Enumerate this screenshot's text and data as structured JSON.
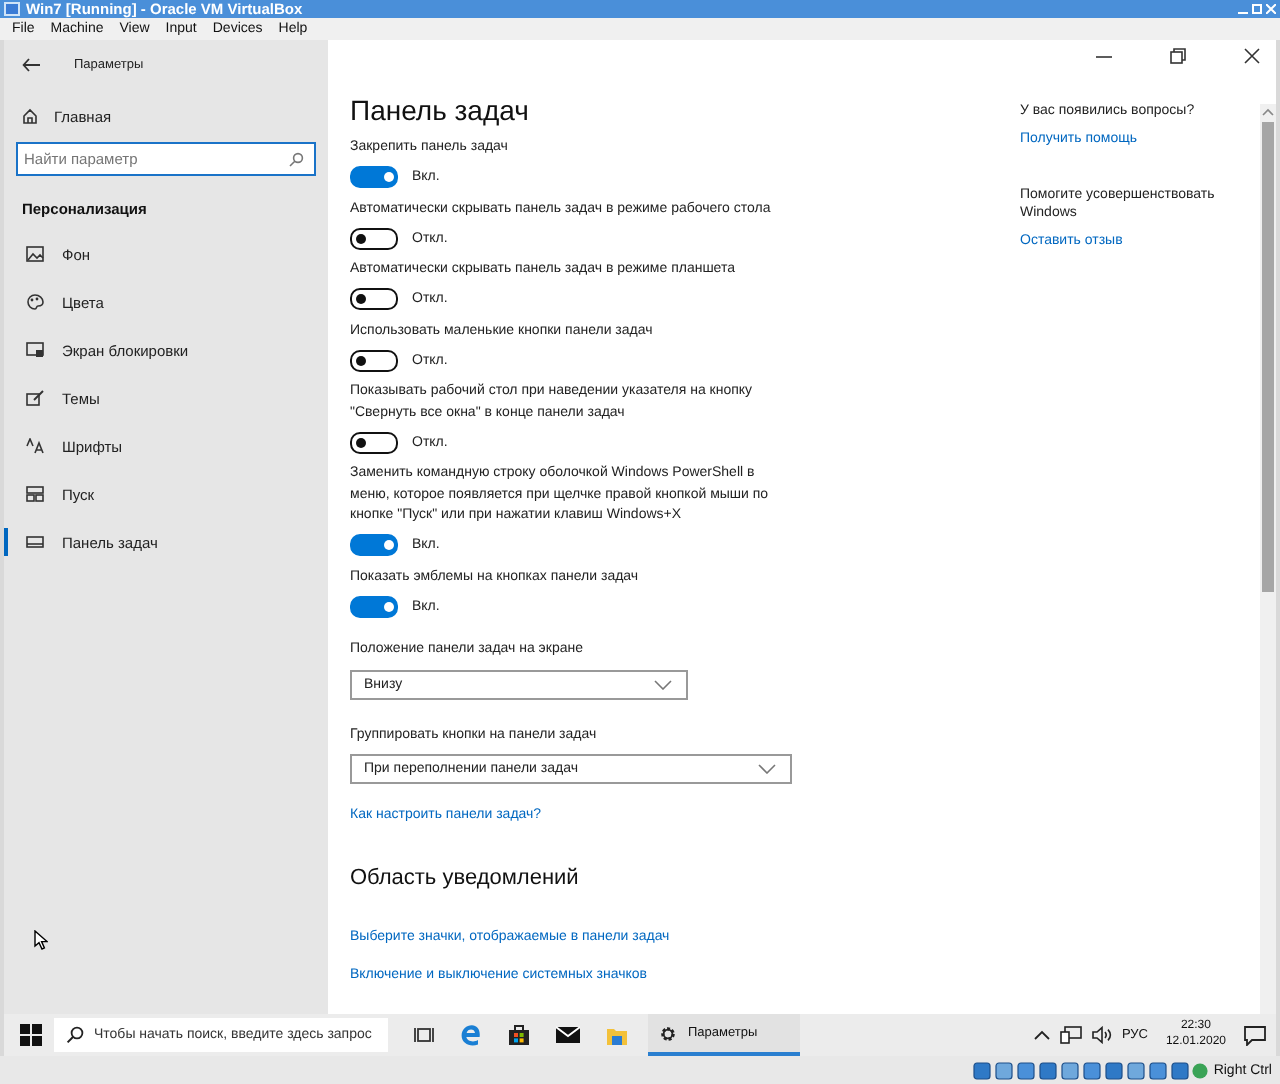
{
  "vbox": {
    "title": "Win7 [Running] - Oracle VM VirtualBox",
    "menu": [
      "File",
      "Machine",
      "View",
      "Input",
      "Devices",
      "Help"
    ]
  },
  "settings": {
    "app_title": "Параметры",
    "home": "Главная",
    "search": {
      "placeholder": "Найти параметр"
    },
    "section": "Персонализация",
    "nav": [
      {
        "label": "Фон",
        "kind": "background",
        "selected": false
      },
      {
        "label": "Цвета",
        "kind": "colors",
        "selected": false
      },
      {
        "label": "Экран блокировки",
        "kind": "lock",
        "selected": false
      },
      {
        "label": "Темы",
        "kind": "themes",
        "selected": false
      },
      {
        "label": "Шрифты",
        "kind": "fonts",
        "selected": false
      },
      {
        "label": "Пуск",
        "kind": "start",
        "selected": false
      },
      {
        "label": "Панель задач",
        "kind": "taskbar",
        "selected": true
      }
    ],
    "page_title": "Панель задач",
    "toggles": [
      {
        "label": "Закрепить панель задач",
        "on": true,
        "state_text": "Вкл."
      },
      {
        "label": "Автоматически скрывать панель задач в режиме рабочего стола",
        "on": false,
        "state_text": "Откл."
      },
      {
        "label": "Автоматически скрывать панель задач в режиме планшета",
        "on": false,
        "state_text": "Откл."
      },
      {
        "label": "Использовать маленькие кнопки панели задач",
        "on": false,
        "state_text": "Откл."
      },
      {
        "label": "Показывать рабочий стол при наведении указателя на кнопку \"Свернуть все окна\" в конце панели задач",
        "on": false,
        "state_text": "Откл."
      },
      {
        "label": "Заменить командную строку оболочкой Windows PowerShell в меню, которое появляется при щелчке правой кнопкой мыши по кнопке \"Пуск\" или при нажатии клавиш Windows+X",
        "on": true,
        "state_text": "Вкл."
      },
      {
        "label": "Показать эмблемы на кнопках панели задач",
        "on": true,
        "state_text": "Вкл."
      }
    ],
    "dropdowns": [
      {
        "label": "Положение панели задач на экране",
        "value": "Внизу"
      },
      {
        "label": "Группировать кнопки на панели задач",
        "value": "При переполнении панели задач"
      }
    ],
    "help_link": "Как настроить панели задач?",
    "notifications_title": "Область уведомлений",
    "links": [
      "Выберите значки, отображаемые в панели задач",
      "Включение и выключение системных значков"
    ],
    "aside": [
      {
        "text": "У вас появились вопросы?",
        "link": "Получить помощь"
      },
      {
        "text": "Помогите усовершенствовать Windows",
        "link": "Оставить отзыв"
      }
    ]
  },
  "taskbar": {
    "search_placeholder": "Чтобы начать поиск, введите здесь запрос",
    "apps": [
      {
        "label": "Параметры",
        "active": true
      }
    ],
    "language": "РУС",
    "time": "22:30",
    "date": "12.01.2020"
  },
  "vbox_status": {
    "host_key": "Right Ctrl"
  }
}
